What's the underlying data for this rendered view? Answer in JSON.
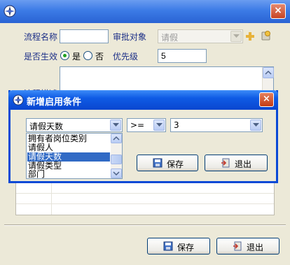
{
  "form": {
    "flow_name_label": "流程名称",
    "flow_name_value": "",
    "approval_target_label": "审批对象",
    "approval_target_value": "请假",
    "effective_label": "是否生效",
    "yes_label": "是",
    "no_label": "否",
    "effective_selected": "yes",
    "priority_label": "优先级",
    "priority_value": "5",
    "description_label": "流程描述"
  },
  "footer": {
    "save_label": "保存",
    "exit_label": "退出"
  },
  "dialog": {
    "title": "新增启用条件",
    "close_label": "×",
    "field_value": "请假天数",
    "operator_value": ">=",
    "value_value": "3",
    "save_label": "保存",
    "exit_label": "退出",
    "field_options": [
      "拥有者岗位类别",
      "请假人",
      "请假天数",
      "请假类型",
      "部门"
    ],
    "selected_option_index": 2
  },
  "outer_close_label": "×",
  "colors": {
    "label": "#1C2F87",
    "title_blue": "#0F5BE5",
    "selection": "#316AC5"
  }
}
